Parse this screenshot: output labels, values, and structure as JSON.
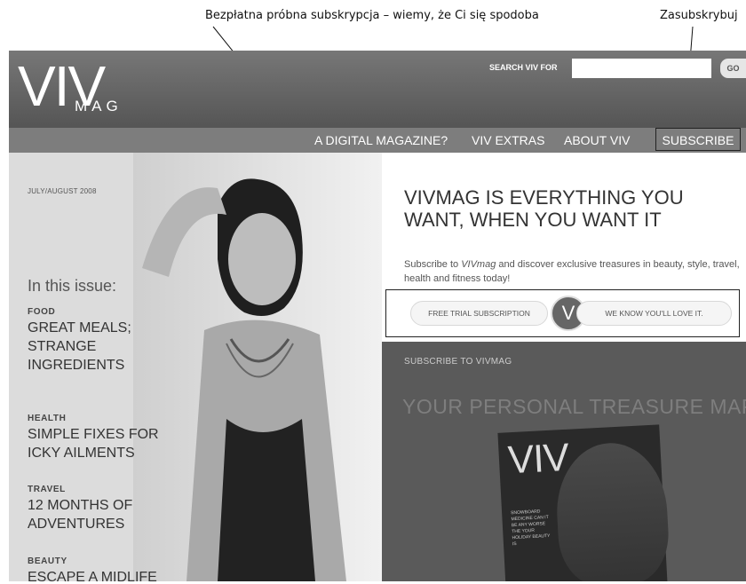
{
  "annotations": {
    "free_trial_caption": "Bezpłatna próbna subskrypcja – wiemy, że Ci się spodoba",
    "subscribe_caption": "Zasubskrybuj"
  },
  "header": {
    "logo_main": "VIV",
    "logo_sub": "MAG",
    "search_label": "SEARCH VIV FOR",
    "search_value": "",
    "go_label": "GO"
  },
  "nav": {
    "items": [
      "A DIGITAL MAGAZINE?",
      "VIV EXTRAS",
      "ABOUT VIV",
      "SUBSCRIBE"
    ]
  },
  "issue": {
    "date": "JULY/AUGUST 2008",
    "heading": "In this issue:",
    "topics": [
      {
        "category": "FOOD",
        "title": "GREAT MEALS; STRANGE INGREDIENTS"
      },
      {
        "category": "HEALTH",
        "title": "SIMPLE FIXES FOR ICKY AILMENTS"
      },
      {
        "category": "TRAVEL",
        "title": "12 MONTHS OF ADVENTURES"
      },
      {
        "category": "BEAUTY",
        "title": "ESCAPE A MIDLIFE"
      }
    ]
  },
  "promo": {
    "title": "VIVMAG IS EVERYTHING YOU WANT, WHEN YOU WANT IT",
    "body_before": "Subscribe to ",
    "body_emphasis": "VIVmag",
    "body_after": " and discover exclusive treasures in beauty, style, travel, health and fitness today!",
    "free_trial_label": "FREE TRIAL SUBSCRIPTION",
    "badge_letter": "V",
    "love_it_label": "WE KNOW YOU'LL LOVE IT."
  },
  "subscribe_panel": {
    "heading": "SUBSCRIBE TO VIVMAG",
    "title": "YOUR PERSONAL TREASURE MAP",
    "cover_logo": "VIV",
    "cover_text": "SNOWBOARD MEDICINE CAN IT BE ANY WORSE THE YOUR HOLIDAY BEAUTY IS"
  }
}
